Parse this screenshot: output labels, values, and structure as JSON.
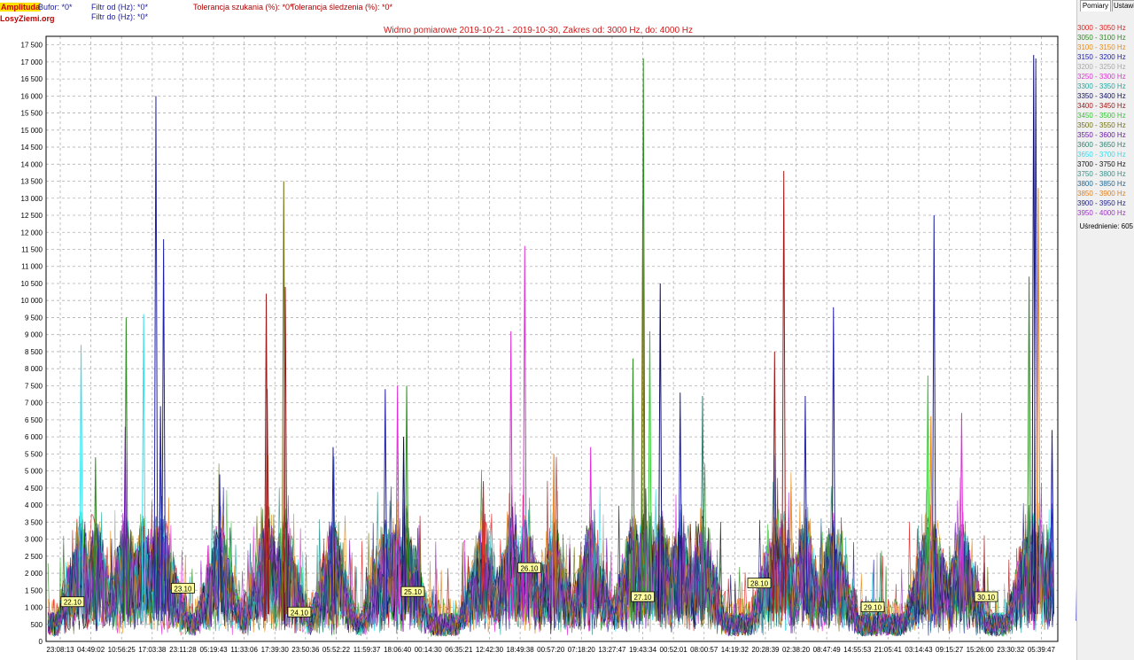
{
  "header": {
    "mode": "Amplituda",
    "site": "LosyZiemi.org",
    "bufor": "Bufor: *0*",
    "filtr_od": "Filtr od (Hz): *0*",
    "filtr_do": "Filtr do (Hz): *0*",
    "tol_szukania": "Tolerancja szukania (%): *0*",
    "tol_sledzenia": "Tolerancja śledzenia (%): *0*"
  },
  "panel": {
    "tabs": [
      "Pomiary",
      "Ustawi"
    ],
    "averaging": "Uśrednienie:  605"
  },
  "chart_data": {
    "type": "line",
    "title": "Widmo pomiarowe 2019-10-21 - 2019-10-30, Zakres od: 3000 Hz, do: 4000 Hz",
    "ylim": [
      0,
      17750
    ],
    "yticks": [
      0,
      500,
      1000,
      1500,
      2000,
      2500,
      3000,
      3500,
      4000,
      4500,
      5000,
      5500,
      6000,
      6500,
      7000,
      7500,
      8000,
      8500,
      9000,
      9500,
      10000,
      10500,
      11000,
      11500,
      12000,
      12500,
      13000,
      13500,
      14000,
      14500,
      15000,
      15500,
      16000,
      16500,
      17000,
      17500
    ],
    "ytick_labels": [
      "0",
      "500",
      "1 000",
      "1 500",
      "2 000",
      "2 500",
      "3 000",
      "3 500",
      "4 000",
      "4 500",
      "5 000",
      "5 500",
      "6 000",
      "6 500",
      "7 000",
      "7 500",
      "8 000",
      "8 500",
      "9 000",
      "9 500",
      "10 000",
      "10 500",
      "11 000",
      "11 500",
      "12 000",
      "12 500",
      "13 000",
      "13 500",
      "14 000",
      "14 500",
      "15 000",
      "15 500",
      "16 000",
      "16 500",
      "17 000",
      "17 500"
    ],
    "xtick_labels": [
      "23:08:13",
      "04:49:02",
      "10:56:25",
      "17:03:38",
      "23:11:28",
      "05:19:43",
      "11:33:06",
      "17:39:30",
      "23:50:36",
      "05:52:22",
      "11:59:37",
      "18:06:40",
      "00:14:30",
      "06:35:21",
      "12:42:30",
      "18:49:38",
      "00:57:20",
      "07:18:20",
      "13:27:47",
      "19:43:34",
      "00:52:01",
      "08:00:57",
      "14:19:32",
      "20:28:39",
      "02:38:20",
      "08:47:49",
      "14:55:53",
      "21:05:41",
      "03:14:43",
      "09:15:27",
      "15:26:00",
      "23:30:32",
      "05:39:47"
    ],
    "grid": true,
    "legend_position": "right",
    "date_markers": [
      {
        "label": "22.10",
        "tick_index": 0.4,
        "value": 1150
      },
      {
        "label": "23.10",
        "tick_index": 4.0,
        "value": 1550
      },
      {
        "label": "24.10",
        "tick_index": 7.8,
        "value": 850
      },
      {
        "label": "25.10",
        "tick_index": 11.5,
        "value": 1450
      },
      {
        "label": "26.10",
        "tick_index": 15.3,
        "value": 2150
      },
      {
        "label": "27.10",
        "tick_index": 19.0,
        "value": 1300
      },
      {
        "label": "28.10",
        "tick_index": 22.8,
        "value": 1700
      },
      {
        "label": "29.10",
        "tick_index": 26.5,
        "value": 1000
      },
      {
        "label": "30.10",
        "tick_index": 30.2,
        "value": 1300
      }
    ],
    "series": [
      {
        "name": "3000 - 3050 Hz",
        "color": "#e02020"
      },
      {
        "name": "3050 - 3100 Hz",
        "color": "#2e8b22"
      },
      {
        "name": "3100 - 3150 Hz",
        "color": "#e88a10"
      },
      {
        "name": "3150 - 3200 Hz",
        "color": "#2020a8"
      },
      {
        "name": "3200 - 3250 Hz",
        "color": "#a8a8a8"
      },
      {
        "name": "3250 - 3300 Hz",
        "color": "#e030d8"
      },
      {
        "name": "3300 - 3350 Hz",
        "color": "#20a8a0"
      },
      {
        "name": "3350 - 3400 Hz",
        "color": "#101060"
      },
      {
        "name": "3400 - 3450 Hz",
        "color": "#a01818"
      },
      {
        "name": "3450 - 3500 Hz",
        "color": "#30c830"
      },
      {
        "name": "3500 - 3550 Hz",
        "color": "#707010"
      },
      {
        "name": "3550 - 3600 Hz",
        "color": "#6818a8"
      },
      {
        "name": "3600 - 3650 Hz",
        "color": "#308070"
      },
      {
        "name": "3650 - 3700 Hz",
        "color": "#30e0f0"
      },
      {
        "name": "3700 - 3750 Hz",
        "color": "#101010"
      },
      {
        "name": "3750 - 3800 Hz",
        "color": "#389088"
      },
      {
        "name": "3800 - 3850 Hz",
        "color": "#206890"
      },
      {
        "name": "3850 - 3900 Hz",
        "color": "#e08020"
      },
      {
        "name": "3900 - 3950 Hz",
        "color": "#202088"
      },
      {
        "name": "3950 - 4000 Hz",
        "color": "#a030c8"
      }
    ],
    "peaks": [
      {
        "tick_index": 0.68,
        "value": 8700,
        "series": 13
      },
      {
        "tick_index": 1.15,
        "value": 5400,
        "series": 1
      },
      {
        "tick_index": 2.15,
        "value": 9500,
        "series": 1
      },
      {
        "tick_index": 2.12,
        "value": 6300,
        "series": 11
      },
      {
        "tick_index": 2.72,
        "value": 9600,
        "series": 13
      },
      {
        "tick_index": 3.12,
        "value": 16000,
        "series": 3
      },
      {
        "tick_index": 3.37,
        "value": 11800,
        "series": 3
      },
      {
        "tick_index": 3.27,
        "value": 6900,
        "series": 3
      },
      {
        "tick_index": 5.2,
        "value": 4900,
        "series": 3
      },
      {
        "tick_index": 6.72,
        "value": 10200,
        "series": 8
      },
      {
        "tick_index": 6.75,
        "value": 7400,
        "series": 8
      },
      {
        "tick_index": 7.29,
        "value": 13500,
        "series": 10
      },
      {
        "tick_index": 7.34,
        "value": 10400,
        "series": 8
      },
      {
        "tick_index": 8.9,
        "value": 5700,
        "series": 3
      },
      {
        "tick_index": 10.6,
        "value": 7400,
        "series": 3
      },
      {
        "tick_index": 11.0,
        "value": 7500,
        "series": 5
      },
      {
        "tick_index": 11.3,
        "value": 7500,
        "series": 1
      },
      {
        "tick_index": 11.2,
        "value": 6000,
        "series": 7
      },
      {
        "tick_index": 13.8,
        "value": 4700,
        "series": 0
      },
      {
        "tick_index": 14.7,
        "value": 9100,
        "series": 5
      },
      {
        "tick_index": 15.15,
        "value": 11600,
        "series": 5
      },
      {
        "tick_index": 16.1,
        "value": 5500,
        "series": 17
      },
      {
        "tick_index": 17.3,
        "value": 5700,
        "series": 5
      },
      {
        "tick_index": 18.68,
        "value": 8300,
        "series": 1
      },
      {
        "tick_index": 19.02,
        "value": 17100,
        "series": 1
      },
      {
        "tick_index": 19.0,
        "value": 12800,
        "series": 10
      },
      {
        "tick_index": 19.23,
        "value": 9100,
        "series": 9
      },
      {
        "tick_index": 19.57,
        "value": 10500,
        "series": 7
      },
      {
        "tick_index": 20.22,
        "value": 7300,
        "series": 3
      },
      {
        "tick_index": 20.95,
        "value": 7200,
        "series": 12
      },
      {
        "tick_index": 23.3,
        "value": 8500,
        "series": 8
      },
      {
        "tick_index": 23.6,
        "value": 13800,
        "series": 8
      },
      {
        "tick_index": 24.3,
        "value": 7200,
        "series": 3
      },
      {
        "tick_index": 25.22,
        "value": 9800,
        "series": 3
      },
      {
        "tick_index": 28.3,
        "value": 7800,
        "series": 9
      },
      {
        "tick_index": 28.5,
        "value": 12500,
        "series": 3
      },
      {
        "tick_index": 28.4,
        "value": 6600,
        "series": 2
      },
      {
        "tick_index": 29.4,
        "value": 6700,
        "series": 5
      },
      {
        "tick_index": 31.6,
        "value": 10700,
        "series": 1
      },
      {
        "tick_index": 31.75,
        "value": 17200,
        "series": 7
      },
      {
        "tick_index": 31.82,
        "value": 17100,
        "series": 3
      },
      {
        "tick_index": 31.9,
        "value": 13300,
        "series": 17
      },
      {
        "tick_index": 32.35,
        "value": 6200,
        "series": 3
      },
      {
        "tick_index": 33.2,
        "value": 4300,
        "series": 3
      }
    ]
  }
}
